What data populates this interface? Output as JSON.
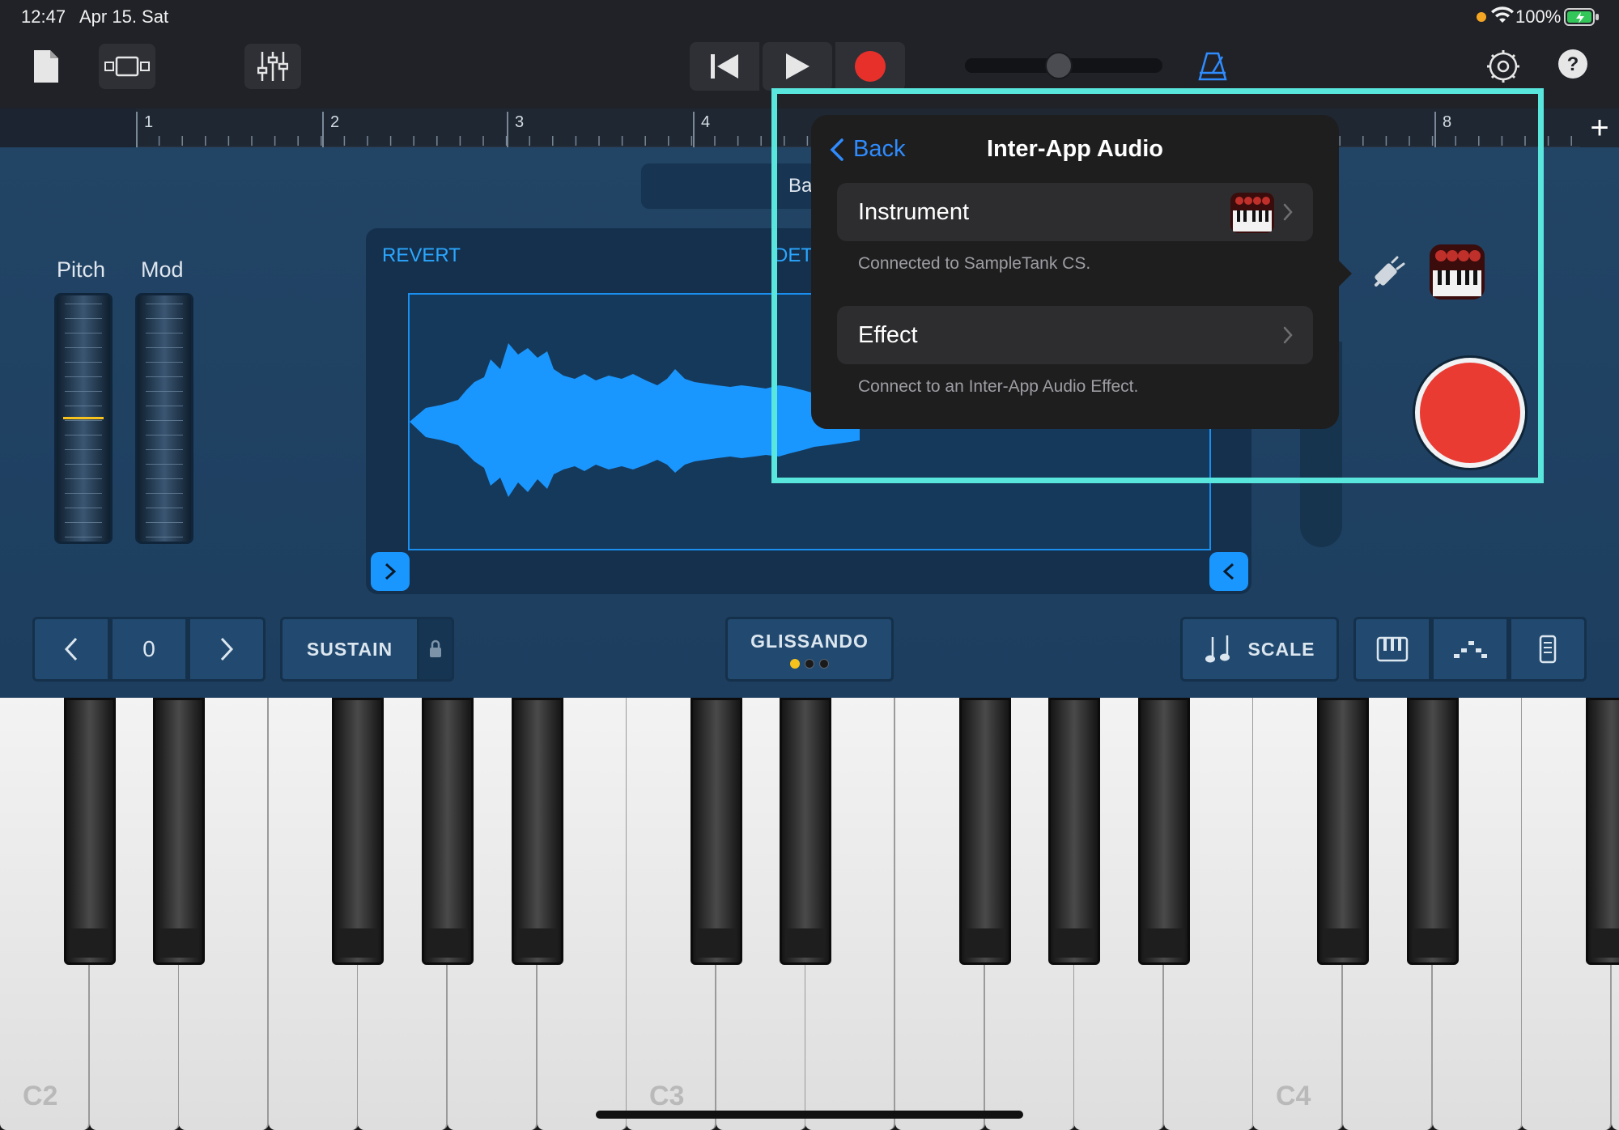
{
  "status_bar": {
    "time": "12:47",
    "date": "Apr 15. Sat",
    "battery": "100%"
  },
  "toolbar": {
    "icons": [
      "document-icon",
      "tracks-view-icon",
      "mixer-icon",
      "rewind-icon",
      "play-icon",
      "record-icon",
      "volume-slider",
      "metronome-icon",
      "settings-icon",
      "help-icon"
    ],
    "volume_level": 0.47,
    "record_color": "#e8302b",
    "metronome_color": "#2f8cff"
  },
  "ruler": {
    "bars": [
      "1",
      "2",
      "3",
      "4",
      "8"
    ],
    "add_label": "+"
  },
  "instrument": {
    "pitch_label": "Pitch",
    "mod_label": "Mod",
    "revert_label": "REVERT",
    "detail_label": "DETA",
    "name_field_text": "Ba"
  },
  "controls": {
    "octave_value": "0",
    "sustain_label": "SUSTAIN",
    "glissando_label": "GLISSANDO",
    "glissando_active_index": 0,
    "scale_label": "SCALE"
  },
  "keyboard": {
    "labels": [
      "C2",
      "C3",
      "C4"
    ]
  },
  "popover": {
    "back_label": "Back",
    "title": "Inter-App Audio",
    "instrument_label": "Instrument",
    "instrument_note": "Connected to SampleTank CS.",
    "effect_label": "Effect",
    "effect_note": "Connect to an Inter-App Audio Effect.",
    "accent_color": "#2f8cff"
  },
  "colors": {
    "highlight": "#59e6dd",
    "waveform": "#1a97ff",
    "record_button": "#ea3b33"
  }
}
